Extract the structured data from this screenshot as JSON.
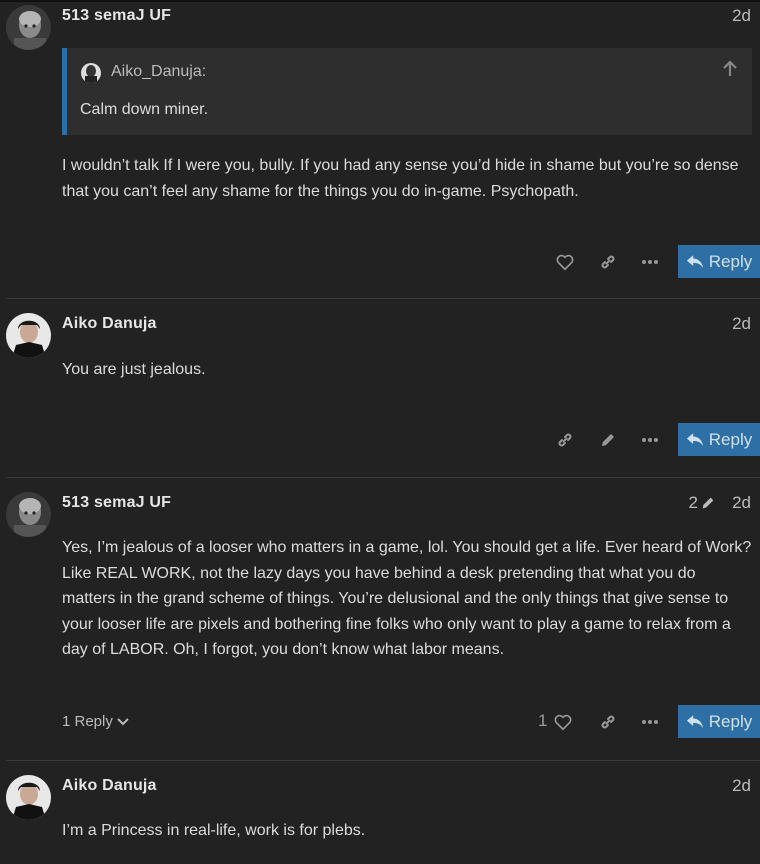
{
  "posts": [
    {
      "username": "513 semaJ UF",
      "date": "2d",
      "quote": {
        "author": "Aiko_Danuja:",
        "text": "Calm down miner."
      },
      "body": "I wouldn’t talk If I were you, bully. If you had any sense you’d hide in shame but you’re so dense that you can’t feel any shame for the things you do in-game. Psychopath.",
      "reply_label": "Reply"
    },
    {
      "username": "Aiko Danuja",
      "date": "2d",
      "body": "You are just jealous.",
      "reply_label": "Reply"
    },
    {
      "username": "513 semaJ UF",
      "date": "2d",
      "edit_count": "2",
      "body": "Yes, I’m jealous of a looser who matters in a game, lol. You should get a life. Ever heard of Work? Like REAL WORK, not the lazy days you have behind a desk pretending that what you do matters in the grand scheme of things. You’re delusional and the only things that give sense to your looser life are pixels and bothering fine folks who only want to play a game to relax from a day of LABOR. Oh, I forgot, you don’t know what labor means.",
      "replies_label": "1 Reply",
      "like_count": "1",
      "reply_label": "Reply"
    },
    {
      "username": "Aiko Danuja",
      "date": "2d",
      "body": "I’m a Princess in real-life, work is for plebs."
    }
  ],
  "colors": {
    "background": "#222222",
    "accent": "#2e6fa5",
    "quote_border": "#2a6fa8"
  },
  "icons": [
    "heart-icon",
    "link-icon",
    "more-icon",
    "reply-arrow-icon",
    "pencil-icon",
    "arrow-up-icon",
    "chevron-down-icon"
  ]
}
